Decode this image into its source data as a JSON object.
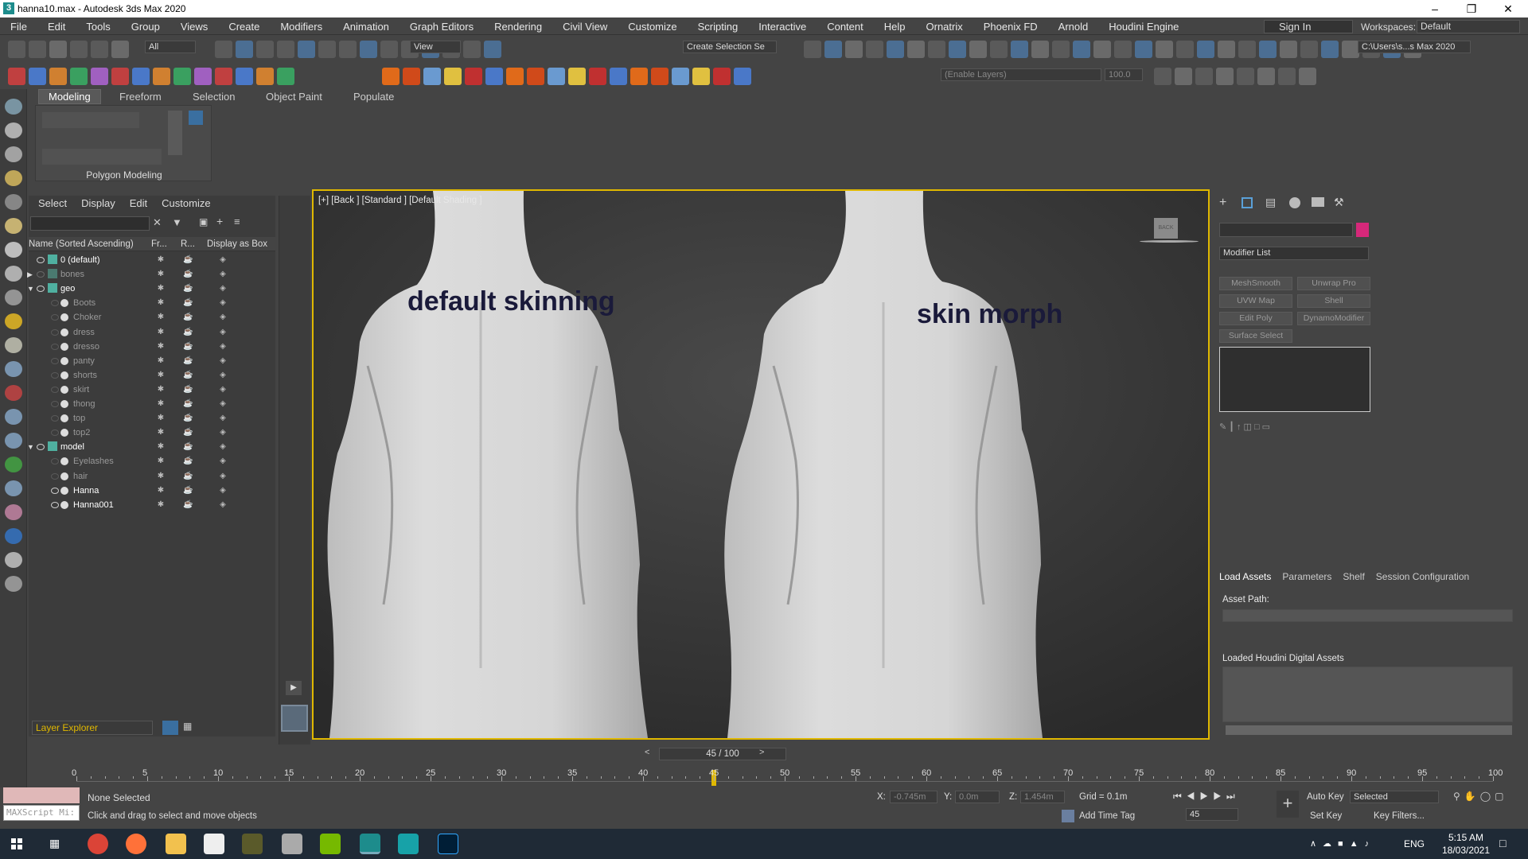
{
  "window": {
    "title": "hanna10.max - Autodesk 3ds Max 2020"
  },
  "menu": [
    "File",
    "Edit",
    "Tools",
    "Group",
    "Views",
    "Create",
    "Modifiers",
    "Animation",
    "Graph Editors",
    "Rendering",
    "Civil View",
    "Customize",
    "Scripting",
    "Interactive",
    "Content",
    "Help",
    "Ornatrix",
    "Phoenix FD",
    "Arnold",
    "Houdini Engine"
  ],
  "account": {
    "sign_in": "Sign In",
    "workspaces_label": "Workspaces:",
    "workspace": "Default"
  },
  "toolbar": {
    "filter": "All",
    "ref_coord": "View",
    "selection_set": "Create Selection Se",
    "path": "C:\\Users\\s...s Max 2020",
    "layers_placeholder": "(Enable Layers)",
    "value": "100.0"
  },
  "ribbon": {
    "tabs": [
      "Modeling",
      "Freeform",
      "Selection",
      "Object Paint",
      "Populate"
    ],
    "panel_label": "Polygon Modeling"
  },
  "explorer": {
    "menu": [
      "Select",
      "Display",
      "Edit",
      "Customize"
    ],
    "columns": {
      "name": "Name (Sorted Ascending)",
      "fr": "Fr...",
      "r": "R...",
      "box": "Display as Box"
    },
    "rows": [
      {
        "label": "0 (default)",
        "indent": 0,
        "type": "layer",
        "visible": true,
        "bright": true
      },
      {
        "label": "bones",
        "indent": 0,
        "type": "layer",
        "visible": false,
        "bright": false,
        "collapsed": true
      },
      {
        "label": "geo",
        "indent": 0,
        "type": "layer",
        "visible": true,
        "bright": true,
        "expanded": true
      },
      {
        "label": "Boots",
        "indent": 1,
        "type": "obj",
        "visible": false
      },
      {
        "label": "Choker",
        "indent": 1,
        "type": "obj",
        "visible": false
      },
      {
        "label": "dress",
        "indent": 1,
        "type": "obj",
        "visible": false
      },
      {
        "label": "dresso",
        "indent": 1,
        "type": "obj",
        "visible": false
      },
      {
        "label": "panty",
        "indent": 1,
        "type": "obj",
        "visible": false
      },
      {
        "label": "shorts",
        "indent": 1,
        "type": "obj",
        "visible": false
      },
      {
        "label": "skirt",
        "indent": 1,
        "type": "obj",
        "visible": false
      },
      {
        "label": "thong",
        "indent": 1,
        "type": "obj",
        "visible": false
      },
      {
        "label": "top",
        "indent": 1,
        "type": "obj",
        "visible": false
      },
      {
        "label": "top2",
        "indent": 1,
        "type": "obj",
        "visible": false
      },
      {
        "label": "model",
        "indent": 0,
        "type": "layer",
        "visible": true,
        "bright": true,
        "expanded": true
      },
      {
        "label": "Eyelashes",
        "indent": 1,
        "type": "obj",
        "visible": false
      },
      {
        "label": "hair",
        "indent": 1,
        "type": "obj",
        "visible": false
      },
      {
        "label": "Hanna",
        "indent": 1,
        "type": "obj",
        "visible": true,
        "bright": true
      },
      {
        "label": "Hanna001",
        "indent": 1,
        "type": "obj",
        "visible": true,
        "bright": true
      }
    ],
    "footer": "Layer Explorer"
  },
  "viewport": {
    "label": "[+] [Back ] [Standard ] [Default Shading ]",
    "caption_left": "default skinning",
    "caption_right": "skin morph",
    "viewcube": "BACK"
  },
  "command_panel": {
    "modifier_list": "Modifier List",
    "modifiers": [
      "MeshSmooth",
      "Unwrap Pro",
      "UVW Map",
      "Shell",
      "Edit Poly",
      "DynamoModifier",
      "Surface Select"
    ],
    "color": "#d6287a"
  },
  "houdini": {
    "tabs": [
      "Load Assets",
      "Parameters",
      "Shelf",
      "Session Configuration"
    ],
    "asset_path_label": "Asset Path:",
    "loaded_label": "Loaded Houdini Digital Assets"
  },
  "timeline": {
    "slider": "45 / 100",
    "current": 45,
    "max": 100,
    "ticks": [
      0,
      5,
      10,
      15,
      20,
      25,
      30,
      35,
      40,
      45,
      50,
      55,
      60,
      65,
      70,
      75,
      80,
      85,
      90,
      95,
      100
    ]
  },
  "status": {
    "selection": "None Selected",
    "prompt": "Click and drag to select and move objects",
    "maxscript": "MAXScript Mi:",
    "x_label": "X:",
    "x": "-0.745m",
    "y_label": "Y:",
    "y": "0.0m",
    "z_label": "Z:",
    "z": "1.454m",
    "grid": "Grid = 0.1m",
    "add_time_tag": "Add Time Tag",
    "auto_key": "Auto Key",
    "selected": "Selected",
    "set_key": "Set Key",
    "key_filters": "Key Filters...",
    "frame": "45"
  },
  "taskbar": {
    "lang": "ENG",
    "time": "5:15 AM",
    "date": "18/03/2021"
  }
}
